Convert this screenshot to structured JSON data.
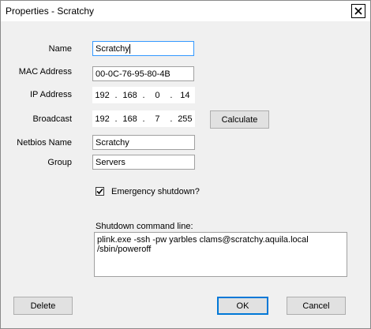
{
  "window": {
    "title": "Properties - Scratchy"
  },
  "fields": {
    "name": {
      "label": "Name",
      "value": "Scratchy"
    },
    "mac": {
      "label": "MAC Address",
      "value": "00-0C-76-95-80-4B"
    },
    "ip": {
      "label": "IP Address",
      "octets": [
        "192",
        "168",
        "0",
        "14"
      ]
    },
    "broadcast": {
      "label": "Broadcast",
      "octets": [
        "192",
        "168",
        "7",
        "255"
      ]
    },
    "netbios": {
      "label": "Netbios Name",
      "value": "Scratchy"
    },
    "group": {
      "label": "Group",
      "value": "Servers"
    }
  },
  "buttons": {
    "calculate": "Calculate",
    "delete": "Delete",
    "ok": "OK",
    "cancel": "Cancel"
  },
  "emergency": {
    "label": "Emergency shutdown?",
    "checked": true
  },
  "shutdown": {
    "label": "Shutdown command line:",
    "lines": [
      "plink.exe -ssh -pw yarbles clams@scratchy.aquila.local",
      "/sbin/poweroff"
    ]
  },
  "icons": {
    "close": "close-icon",
    "check": "checkmark-icon"
  }
}
